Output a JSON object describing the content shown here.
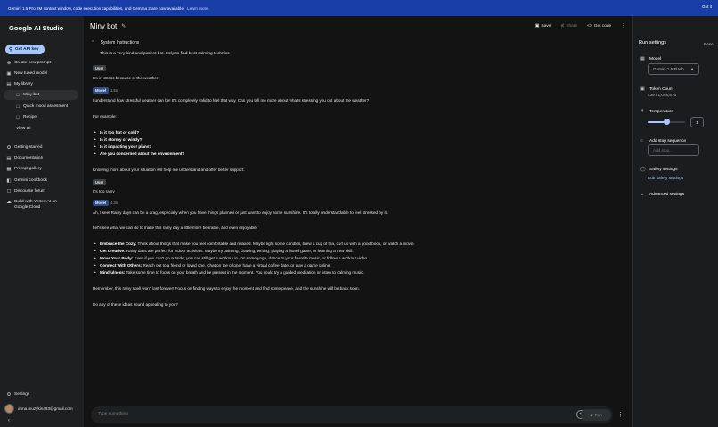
{
  "banner": {
    "text": "Gemini 1.5 Pro 2M context window, code execution capabilities, and Gemma 2 are now available.",
    "link": "Learn more.",
    "dismiss": "Got it"
  },
  "sidebar": {
    "logo": "Google AI Studio",
    "api_key": "Get API key",
    "items": [
      {
        "label": "Create new prompt",
        "icon": "add-circle-icon"
      },
      {
        "label": "New tuned model",
        "icon": "tune-icon"
      },
      {
        "label": "My library",
        "icon": "folder-icon"
      }
    ],
    "library": [
      {
        "label": "Miny bot",
        "icon": "chat-icon"
      },
      {
        "label": "Quick mood assesment",
        "icon": "chat-icon"
      },
      {
        "label": "Recipe",
        "icon": "chat-icon"
      }
    ],
    "view_all": "View all",
    "resources": [
      {
        "label": "Getting started",
        "icon": "gear-icon"
      },
      {
        "label": "Documentation",
        "icon": "doc-icon"
      },
      {
        "label": "Prompt gallery",
        "icon": "gallery-icon"
      },
      {
        "label": "Gemini cookbook",
        "icon": "book-icon"
      },
      {
        "label": "Discourse forum",
        "icon": "forum-icon"
      },
      {
        "label": "Build with Vertex AI on",
        "label2": "Google Cloud",
        "icon": "cloud-icon"
      }
    ],
    "settings": "Settings",
    "user_email": "anna.muzykina83@gmail.com"
  },
  "header": {
    "title": "Miny bot",
    "save": "Save",
    "share": "Share",
    "get_code": "Get code"
  },
  "system": {
    "label": "System Instructions",
    "text": "This is a very kind and patient bot. Help to find best calming technics"
  },
  "chat": {
    "user_label": "User",
    "model_label": "Model",
    "m1_user": "I'm in stress because of the weather",
    "m1_time": "1.5s",
    "m1_p1": "I understand how stressful weather can be! It's completely valid to feel that way. Can you tell me more about what's stressing you out about the weather?",
    "m1_p2": "For example:",
    "m1_b1": "Is it too hot or cold?",
    "m1_b2": "Is it stormy or windy?",
    "m1_b3": "Is it impacting your plans?",
    "m1_b4": "Are you concerned about the environment?",
    "m1_p3": "Knowing more about your situation will help me understand and offer better support.",
    "m2_user": "It's too rainy",
    "m2_time": "4.3s",
    "m2_p1": "Ah, I see! Rainy days can be a drag, especially when you have things planned or just want to enjoy some sunshine. It's totally understandable to feel stressed by it.",
    "m2_p2": "Let's see what we can do to make this rainy day a little more bearable, and even enjoyable!",
    "m2_b1_t": "Embrace the Cozy:",
    "m2_b1": " Think about things that make you feel comfortable and relaxed. Maybe light some candles, brew a cup of tea, curl up with a good book, or watch a movie.",
    "m2_b2_t": "Get Creative:",
    "m2_b2": " Rainy days are perfect for indoor activities. Maybe try painting, drawing, writing, playing a board game, or learning a new skill.",
    "m2_b3_t": "Move Your Body:",
    "m2_b3": " Even if you can't go outside, you can still get a workout in. Do some yoga, dance to your favorite music, or follow a workout video.",
    "m2_b4_t": "Connect With Others:",
    "m2_b4": " Reach out to a friend or loved one. Chat on the phone, have a virtual coffee date, or play a game online.",
    "m2_b5_t": "Mindfulness:",
    "m2_b5": " Take some time to focus on your breath and be present in the moment. You could try a guided meditation or listen to calming music.",
    "m2_p3": "Remember, this rainy spell won't last forever! Focus on finding ways to enjoy the moment and find some peace, and the sunshine will be back soon.",
    "m2_p4": "Do any of these ideas sound appealing to you?"
  },
  "input": {
    "placeholder": "Type something",
    "run": "Run"
  },
  "run_settings": {
    "title": "Run settings",
    "reset": "Reset",
    "model_label": "Model",
    "model_value": "Gemini 1.5 Flash",
    "token_label": "Token Count",
    "token_value": "439 / 1,048,576",
    "temp_label": "Temperature",
    "temp_value": "1",
    "temp_fraction": 0.5,
    "stop_label": "Add stop sequence",
    "stop_placeholder": "Add stop...",
    "safety_label": "Safety settings",
    "safety_link": "Edit safety settings",
    "advanced": "Advanced settings"
  },
  "colors": {
    "banner": "#1a3ea8",
    "accent": "#a8c7fa",
    "sidebar": "#1e1f20",
    "background": "#131314"
  }
}
